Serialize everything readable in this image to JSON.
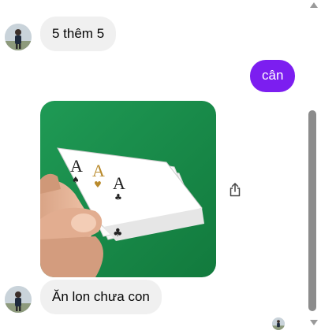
{
  "messages": {
    "msg1": {
      "text": "5 thêm 5"
    },
    "msg2": {
      "text": "cân"
    },
    "msg3": {
      "image": "photo of a hand holding playing cards (three aces) over green felt"
    },
    "msg4": {
      "text": "Ăn lon chưa con"
    }
  },
  "icons": {
    "share": "share-icon",
    "seen": "seen-avatar"
  },
  "colors": {
    "outgoing_bubble": "#7c1ef0",
    "incoming_bubble": "#f0f0f0",
    "scroll_thumb": "#8c8c8c"
  },
  "scroll": {
    "position": 0.55
  }
}
